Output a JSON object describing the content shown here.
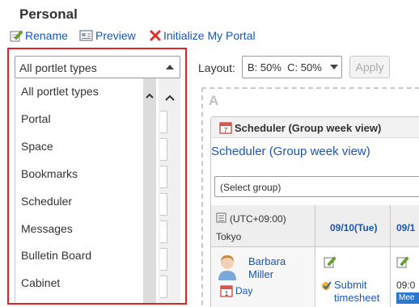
{
  "page": {
    "title": "Personal"
  },
  "toolbar": {
    "rename": "Rename",
    "preview": "Preview",
    "initialize": "Initialize My Portal"
  },
  "portlet_filter": {
    "selected": "All portlet types",
    "options": [
      "All portlet types",
      "Portal",
      "Space",
      "Bookmarks",
      "Scheduler",
      "Messages",
      "Bulletin Board",
      "Cabinet"
    ]
  },
  "layout": {
    "label": "Layout:",
    "value": "B: 50%  C: 50%",
    "apply": "Apply"
  },
  "zone": {
    "label": "A"
  },
  "portlet": {
    "header_title": "Scheduler (Group week view)",
    "link_title": "Scheduler (Group week view)",
    "group_select": "(Select group)",
    "timezone": "(UTC+09:00)",
    "city": "Tokyo",
    "dates": [
      "09/10(Tue)",
      "09/1"
    ],
    "user": {
      "first": "Barbara",
      "last": "Miller"
    },
    "day": "Day",
    "event": {
      "line1": "Submit",
      "line2": "timesheet"
    },
    "time": "09:0",
    "badge": "Mee"
  },
  "colors": {
    "highlight_border": "#e02424",
    "link": "#1a56b8",
    "badge": "#2b78d0"
  }
}
